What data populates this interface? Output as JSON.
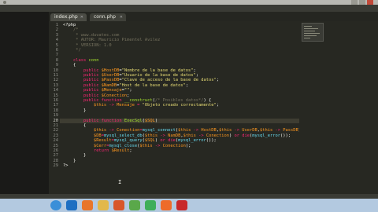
{
  "window": {
    "title": ""
  },
  "tabs": [
    {
      "label": "index.php",
      "active": false
    },
    {
      "label": "conn.php",
      "active": true
    }
  ],
  "editor": {
    "highlight_line": 20,
    "lines": [
      {
        "n": "1",
        "tokens": [
          [
            "pl",
            "<?php"
          ]
        ]
      },
      {
        "n": "2",
        "tokens": [
          [
            "cm",
            "    /*"
          ]
        ]
      },
      {
        "n": "3",
        "tokens": [
          [
            "cm",
            "     * www.duvatec.com"
          ]
        ]
      },
      {
        "n": "4",
        "tokens": [
          [
            "cm",
            "     * AUTOR: Mauricio Pimentel Avilez"
          ]
        ]
      },
      {
        "n": "5",
        "tokens": [
          [
            "cm",
            "     * VERSION: 1.0"
          ]
        ]
      },
      {
        "n": "6",
        "tokens": [
          [
            "cm",
            "     */"
          ]
        ]
      },
      {
        "n": "7",
        "tokens": [
          [
            "pl",
            ""
          ]
        ]
      },
      {
        "n": "8",
        "tokens": [
          [
            "kw",
            "    class "
          ],
          [
            "fn",
            "conn"
          ]
        ]
      },
      {
        "n": "9",
        "tokens": [
          [
            "pl",
            "    {"
          ]
        ]
      },
      {
        "n": "10",
        "tokens": [
          [
            "kw",
            "        public "
          ],
          [
            "dv",
            "$HostDB"
          ],
          [
            "pl",
            "="
          ],
          [
            "st",
            "\"Nombre de la base de datos\""
          ],
          [
            "pl",
            ";"
          ]
        ]
      },
      {
        "n": "11",
        "tokens": [
          [
            "kw",
            "        public "
          ],
          [
            "dv",
            "$UserDB"
          ],
          [
            "pl",
            "="
          ],
          [
            "st",
            "\"Usuario de la base de datos\""
          ],
          [
            "pl",
            ";"
          ]
        ]
      },
      {
        "n": "12",
        "tokens": [
          [
            "kw",
            "        public "
          ],
          [
            "dv",
            "$PassDB"
          ],
          [
            "pl",
            "="
          ],
          [
            "st",
            "\"Clave de acceso de la base de datos\""
          ],
          [
            "pl",
            ";"
          ]
        ]
      },
      {
        "n": "13",
        "tokens": [
          [
            "kw",
            "        public "
          ],
          [
            "dv",
            "$NamDB"
          ],
          [
            "pl",
            "="
          ],
          [
            "st",
            "\"Host de la base de datos\""
          ],
          [
            "pl",
            ";"
          ]
        ]
      },
      {
        "n": "14",
        "tokens": [
          [
            "kw",
            "        public "
          ],
          [
            "dv",
            "$Mensaje"
          ],
          [
            "pl",
            "="
          ],
          [
            "st",
            "\"\""
          ],
          [
            "pl",
            ";"
          ]
        ]
      },
      {
        "n": "15",
        "tokens": [
          [
            "kw",
            "        public "
          ],
          [
            "dv",
            "$Conection"
          ],
          [
            "pl",
            ";"
          ]
        ]
      },
      {
        "n": "16",
        "tokens": [
          [
            "kw",
            "        public function "
          ],
          [
            "fn",
            "__construct"
          ],
          [
            "pl",
            "("
          ],
          [
            "cm",
            "/* Posibles datos*/"
          ],
          [
            "pl",
            ") {"
          ]
        ]
      },
      {
        "n": "17",
        "tokens": [
          [
            "dv",
            "            $this "
          ],
          [
            "kw",
            "-> "
          ],
          [
            "dv",
            "Mensaje "
          ],
          [
            "kw",
            "= "
          ],
          [
            "st",
            "\"Objeto creado correctamente\""
          ],
          [
            "pl",
            ";"
          ]
        ]
      },
      {
        "n": "18",
        "tokens": [
          [
            "pl",
            "        }"
          ]
        ]
      },
      {
        "n": "19",
        "tokens": [
          [
            "pl",
            ""
          ]
        ]
      },
      {
        "n": "20",
        "tokens": [
          [
            "kw",
            "        public function "
          ],
          [
            "fn",
            "ExecSql"
          ],
          [
            "pl",
            "("
          ],
          [
            "dv",
            "$SQL"
          ],
          [
            "pl",
            ")"
          ]
        ]
      },
      {
        "n": "21",
        "tokens": [
          [
            "pl",
            "        {"
          ]
        ]
      },
      {
        "n": "22",
        "tokens": [
          [
            "dv",
            "            $this "
          ],
          [
            "kw",
            "-> "
          ],
          [
            "dv",
            "Conection"
          ],
          [
            "kw",
            "="
          ],
          [
            "bl",
            "mysql_connect"
          ],
          [
            "pl",
            "("
          ],
          [
            "dv",
            "$this "
          ],
          [
            "kw",
            "-> "
          ],
          [
            "dv",
            "HostDB"
          ],
          [
            "pl",
            ","
          ],
          [
            "dv",
            "$this "
          ],
          [
            "kw",
            "-> "
          ],
          [
            "dv",
            "UserDB"
          ],
          [
            "pl",
            ","
          ],
          [
            "dv",
            "$this "
          ],
          [
            "kw",
            "-> "
          ],
          [
            "dv",
            "PassDB"
          ],
          [
            "pl",
            ") "
          ],
          [
            "kw",
            "or d"
          ]
        ]
      },
      {
        "n": "23",
        "tokens": [
          [
            "dv",
            "            $DB"
          ],
          [
            "kw",
            "="
          ],
          [
            "bl",
            "mysql_select_db"
          ],
          [
            "pl",
            "("
          ],
          [
            "dv",
            "$this "
          ],
          [
            "kw",
            "-> "
          ],
          [
            "dv",
            "NamDB"
          ],
          [
            "pl",
            ","
          ],
          [
            "dv",
            "$this "
          ],
          [
            "kw",
            "-> "
          ],
          [
            "dv",
            "Conection"
          ],
          [
            "pl",
            ") "
          ],
          [
            "kw",
            "or die"
          ],
          [
            "pl",
            "("
          ],
          [
            "bl",
            "mysql_error"
          ],
          [
            "pl",
            "());"
          ]
        ]
      },
      {
        "n": "24",
        "tokens": [
          [
            "dv",
            "            $Result"
          ],
          [
            "kw",
            "="
          ],
          [
            "bl",
            "mysql_query"
          ],
          [
            "pl",
            "("
          ],
          [
            "dv",
            "$SQL"
          ],
          [
            "pl",
            ") "
          ],
          [
            "kw",
            "or die"
          ],
          [
            "pl",
            "("
          ],
          [
            "bl",
            "mysql_error"
          ],
          [
            "pl",
            "());"
          ]
        ]
      },
      {
        "n": "25",
        "tokens": [
          [
            "dv",
            "            $Cerr"
          ],
          [
            "kw",
            "="
          ],
          [
            "bl",
            "mysql_close"
          ],
          [
            "pl",
            "("
          ],
          [
            "dv",
            "$this "
          ],
          [
            "kw",
            "-> "
          ],
          [
            "dv",
            "Conection"
          ],
          [
            "pl",
            ");"
          ]
        ]
      },
      {
        "n": "26",
        "tokens": [
          [
            "kw",
            "            return "
          ],
          [
            "dv",
            "$Result"
          ],
          [
            "pl",
            ";"
          ]
        ]
      },
      {
        "n": "27",
        "tokens": [
          [
            "pl",
            "        }"
          ]
        ]
      },
      {
        "n": "28",
        "tokens": [
          [
            "pl",
            "    }"
          ]
        ]
      },
      {
        "n": "29",
        "tokens": [
          [
            "pl",
            "?>"
          ]
        ]
      }
    ]
  },
  "taskbar": {
    "icons": [
      {
        "name": "windows-start-icon",
        "color": "#3a8fd8"
      },
      {
        "name": "ie-icon",
        "color": "#1e6fc2"
      },
      {
        "name": "firefox-icon",
        "color": "#e8762a"
      },
      {
        "name": "folder-icon",
        "color": "#e2b84a"
      },
      {
        "name": "media-player-icon",
        "color": "#d8562a"
      },
      {
        "name": "chrome-icon",
        "color": "#5aa84a"
      },
      {
        "name": "camtasia-icon",
        "color": "#3fae5a"
      },
      {
        "name": "sublime-icon",
        "color": "#ee6b2a"
      },
      {
        "name": "opera-icon",
        "color": "#c8282a"
      }
    ],
    "clock": ""
  }
}
